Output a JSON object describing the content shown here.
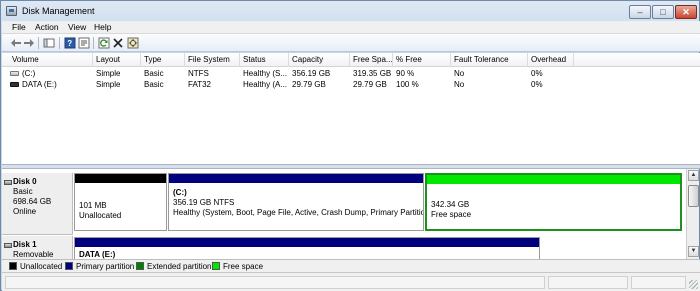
{
  "window": {
    "title": "Disk Management"
  },
  "menu": [
    "File",
    "Action",
    "View",
    "Help"
  ],
  "toolbar_icons": [
    "back-arrow-icon",
    "forward-arrow-icon",
    "show-hide-console-tree-icon",
    "help-icon",
    "properties-icon",
    "refresh-icon",
    "delete-icon",
    "settings-icon"
  ],
  "volume_list": {
    "headers": [
      "Volume",
      "Layout",
      "Type",
      "File System",
      "Status",
      "Capacity",
      "Free Spa...",
      "% Free",
      "Fault Tolerance",
      "Overhead"
    ],
    "rows": [
      [
        "(C:)",
        "Simple",
        "Basic",
        "NTFS",
        "Healthy (S...",
        "356.19 GB",
        "319.35 GB",
        "90 %",
        "No",
        "0%"
      ],
      [
        "DATA (E:)",
        "Simple",
        "Basic",
        "FAT32",
        "Healthy (A...",
        "29.79 GB",
        "29.79 GB",
        "100 %",
        "No",
        "0%"
      ]
    ]
  },
  "disks": [
    {
      "name": "Disk 0",
      "type": "Basic",
      "size": "698.64 GB",
      "status": "Online",
      "partitions": [
        {
          "kind": "unallocated",
          "title": "",
          "line1": "101 MB",
          "line2": "Unallocated"
        },
        {
          "kind": "primary",
          "title": "(C:)",
          "line1": "356.19 GB NTFS",
          "line2": "Healthy (System, Boot, Page File, Active, Crash Dump, Primary Partition)"
        },
        {
          "kind": "free",
          "title": "",
          "line1": "342.34 GB",
          "line2": "Free space"
        }
      ]
    },
    {
      "name": "Disk 1",
      "type": "Removable",
      "partitions": [
        {
          "kind": "primary",
          "title": "DATA (E:)"
        }
      ]
    }
  ],
  "legend": [
    {
      "label": "Unallocated",
      "color": "#000000"
    },
    {
      "label": "Primary partition",
      "color": "#00007f"
    },
    {
      "label": "Extended partition",
      "color": "#008000"
    },
    {
      "label": "Free space",
      "color": "#00e800"
    }
  ],
  "colors": {
    "unallocated": "#000000",
    "primary": "#00007f",
    "free": "#00e800",
    "selection_border": "#1f8f1f"
  }
}
